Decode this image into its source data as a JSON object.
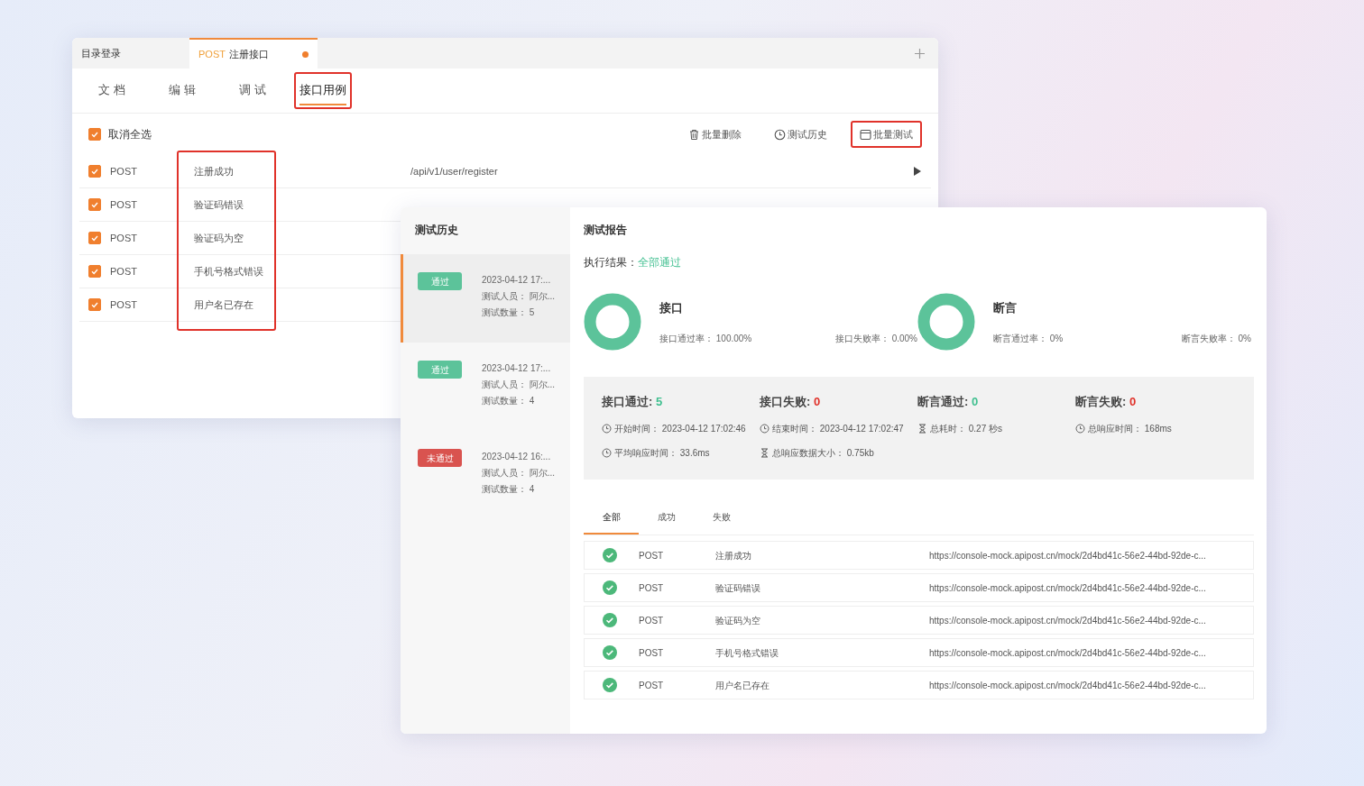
{
  "back_window": {
    "tabs": [
      {
        "label": "目录登录",
        "selected": false,
        "unsaved": false
      },
      {
        "method": "POST",
        "label": "注册接口",
        "selected": true,
        "unsaved": true
      }
    ],
    "subtabs": [
      {
        "label": "文 档",
        "selected": false,
        "highlighted": false
      },
      {
        "label": "编 辑",
        "selected": false,
        "highlighted": false
      },
      {
        "label": "调 试",
        "selected": false,
        "highlighted": false
      },
      {
        "label": "接口用例",
        "selected": true,
        "highlighted": true
      }
    ],
    "select_all": {
      "label": "取消全选",
      "checked": true
    },
    "actions": [
      {
        "label": "批量删除",
        "kind": "trash",
        "highlighted": false
      },
      {
        "label": "测试历史",
        "kind": "clock",
        "highlighted": false
      },
      {
        "label": "批量测试",
        "kind": "window",
        "highlighted": true
      }
    ],
    "names_highlighted": true,
    "cases": [
      {
        "checked": true,
        "method": "POST",
        "name": "注册成功",
        "url": "/api/v1/user/register"
      },
      {
        "checked": true,
        "method": "POST",
        "name": "验证码错误"
      },
      {
        "checked": true,
        "method": "POST",
        "name": "验证码为空"
      },
      {
        "checked": true,
        "method": "POST",
        "name": "手机号格式错误"
      },
      {
        "checked": true,
        "method": "POST",
        "name": "用户名已存在"
      }
    ]
  },
  "front_window": {
    "history": {
      "title": "测试历史",
      "items": [
        {
          "passed": true,
          "badge": "通过",
          "time": "2023-04-12 17:...",
          "tester": "测试人员： 阿尔...",
          "count": "测试数量： 5",
          "selected": true
        },
        {
          "passed": true,
          "badge": "通过",
          "time": "2023-04-12 17:...",
          "tester": "测试人员： 阿尔...",
          "count": "测试数量： 4",
          "selected": false
        },
        {
          "passed": false,
          "badge": "未通过",
          "time": "2023-04-12 16:...",
          "tester": "测试人员： 阿尔...",
          "count": "测试数量： 4",
          "selected": false
        }
      ]
    },
    "report": {
      "title": "测试报告",
      "result_label": "执行结果：",
      "result": "全部通过",
      "summaries": [
        {
          "title": "接口",
          "stats": [
            {
              "label": "接口通过率：",
              "value": "100.00%"
            },
            {
              "label": "接口失败率：",
              "value": "0.00%"
            }
          ]
        },
        {
          "title": "断言",
          "stats": [
            {
              "label": "断言通过率：",
              "value": "0%"
            },
            {
              "label": "断言失败率：",
              "value": "0%"
            }
          ]
        }
      ],
      "counters": [
        {
          "label": "接口通过:",
          "value": "5",
          "kind": "pass"
        },
        {
          "label": "接口失败:",
          "value": "0",
          "kind": "fail"
        },
        {
          "label": "断言通过:",
          "value": "0",
          "kind": "pass"
        },
        {
          "label": "断言失败:",
          "value": "0",
          "kind": "fail"
        }
      ],
      "details": [
        {
          "kind": "clock",
          "text": "开始时间： 2023-04-12 17:02:46"
        },
        {
          "kind": "clock",
          "text": "结束时间： 2023-04-12 17:02:47"
        },
        {
          "kind": "hourglass",
          "text": "总耗时： 0.27 秒s"
        },
        {
          "kind": "clock",
          "text": "总响应时间： 168ms"
        },
        {
          "kind": "clock",
          "text": "平均响应时间： 33.6ms"
        },
        {
          "kind": "hourglass",
          "text": "总响应数据大小： 0.75kb"
        }
      ],
      "result_tabs": [
        {
          "label": "全部",
          "selected": true
        },
        {
          "label": "成功",
          "selected": false
        },
        {
          "label": "失败",
          "selected": false
        }
      ],
      "results": [
        {
          "passed": true,
          "method": "POST",
          "name": "注册成功",
          "url": "https://console-mock.apipost.cn/mock/2d4bd41c-56e2-44bd-92de-c..."
        },
        {
          "passed": true,
          "method": "POST",
          "name": "验证码错误",
          "url": "https://console-mock.apipost.cn/mock/2d4bd41c-56e2-44bd-92de-c..."
        },
        {
          "passed": true,
          "method": "POST",
          "name": "验证码为空",
          "url": "https://console-mock.apipost.cn/mock/2d4bd41c-56e2-44bd-92de-c..."
        },
        {
          "passed": true,
          "method": "POST",
          "name": "手机号格式错误",
          "url": "https://console-mock.apipost.cn/mock/2d4bd41c-56e2-44bd-92de-c..."
        },
        {
          "passed": true,
          "method": "POST",
          "name": "用户名已存在",
          "url": "https://console-mock.apipost.cn/mock/2d4bd41c-56e2-44bd-92de-c..."
        }
      ]
    }
  }
}
